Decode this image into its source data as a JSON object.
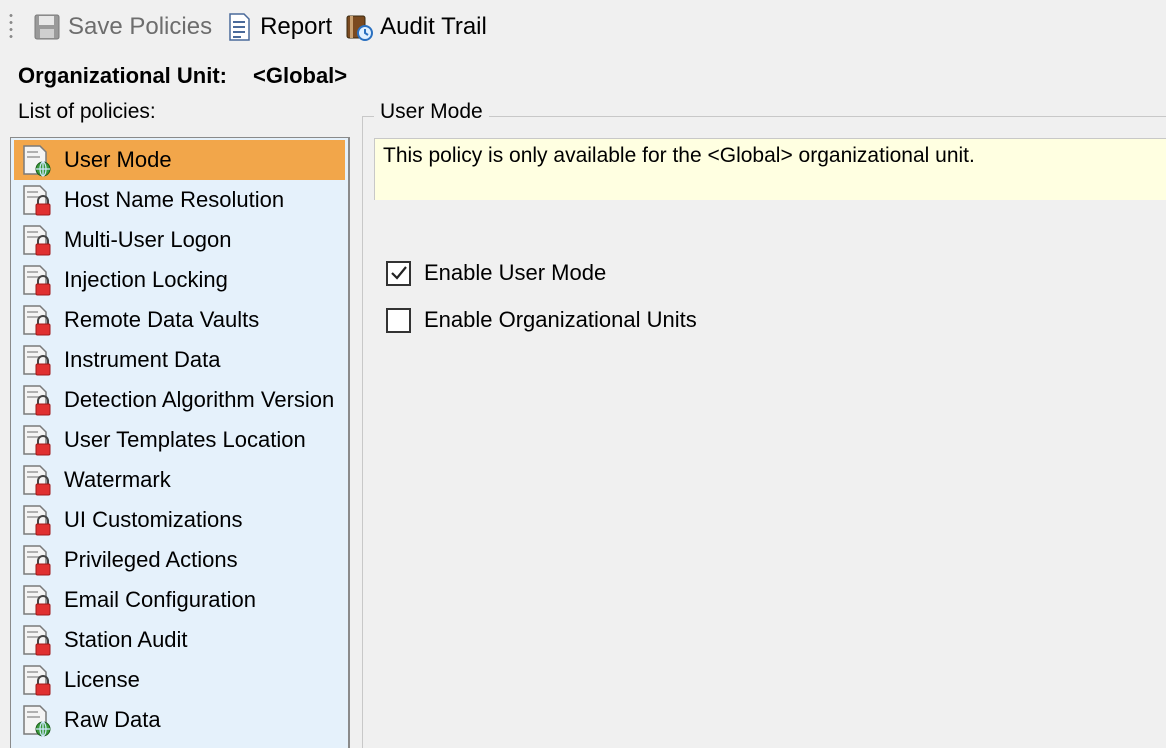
{
  "toolbar": {
    "save_label": "Save Policies",
    "report_label": "Report",
    "audit_label": "Audit Trail"
  },
  "ou": {
    "label": "Organizational Unit:",
    "value": "<Global>"
  },
  "list": {
    "caption": "List of policies:",
    "items": [
      {
        "label": "User Mode",
        "icon": "globe-policy-icon",
        "selected": true
      },
      {
        "label": "Host Name Resolution",
        "icon": "lock-policy-icon"
      },
      {
        "label": "Multi-User Logon",
        "icon": "lock-policy-icon"
      },
      {
        "label": "Injection Locking",
        "icon": "lock-policy-icon"
      },
      {
        "label": "Remote Data Vaults",
        "icon": "lock-policy-icon"
      },
      {
        "label": "Instrument Data",
        "icon": "lock-policy-icon"
      },
      {
        "label": "Detection Algorithm Version",
        "icon": "lock-policy-icon"
      },
      {
        "label": "User Templates Location",
        "icon": "lock-policy-icon"
      },
      {
        "label": "Watermark",
        "icon": "lock-policy-icon"
      },
      {
        "label": "UI Customizations",
        "icon": "lock-policy-icon"
      },
      {
        "label": "Privileged Actions",
        "icon": "lock-policy-icon"
      },
      {
        "label": "Email Configuration",
        "icon": "lock-policy-icon"
      },
      {
        "label": "Station Audit",
        "icon": "lock-policy-icon"
      },
      {
        "label": "License",
        "icon": "lock-policy-icon"
      },
      {
        "label": "Raw Data",
        "icon": "globe-policy-icon"
      }
    ]
  },
  "detail": {
    "group_title": "User Mode",
    "info_text": "This policy is only available for the <Global> organizational unit.",
    "checkboxes": [
      {
        "label": "Enable User Mode",
        "checked": true
      },
      {
        "label": "Enable Organizational Units",
        "checked": false
      }
    ]
  },
  "colors": {
    "selected": "#f2a64a",
    "list_bg": "#e5f1fb",
    "info_bg": "#ffffe1"
  }
}
